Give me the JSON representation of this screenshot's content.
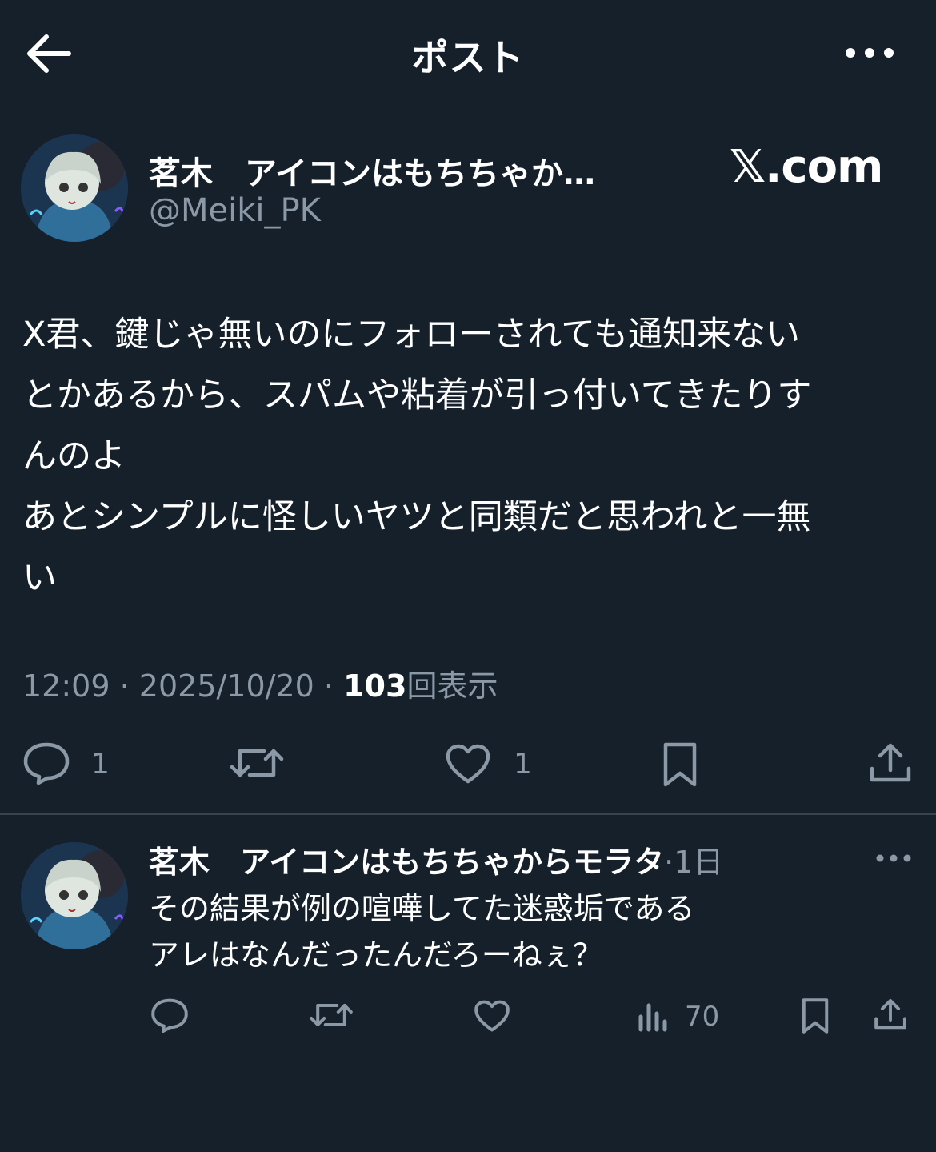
{
  "header": {
    "title": "ポスト",
    "back_icon": "arrow-left-icon",
    "more_icon": "more-horizontal-icon"
  },
  "post": {
    "author_name": "茗木　アイコンはもちちゃか…",
    "handle": "@Meiki_PK",
    "watermark": "𝕏.com",
    "body_lines": [
      "X君、鍵じゃ無いのにフォローされても通知来ない",
      "とかあるから、スパムや粘着が引っ付いてきたりす",
      "んのよ",
      "あとシンプルに怪しいヤツと同類だと思われと一無",
      "い"
    ],
    "time": "12:09",
    "sep": "·",
    "date": "2025/10/20",
    "views_count": "103",
    "views_label": "回表示",
    "actions": {
      "reply_count": "1",
      "like_count": "1"
    }
  },
  "reply": {
    "author_name": "茗木　アイコンはもちちゃからモラタ",
    "time": "·1日",
    "body_lines": [
      "その結果が例の喧嘩してた迷惑垢である",
      "アレはなんだったんだろーねぇ？"
    ],
    "views_count": "70"
  },
  "colors": {
    "background": "#15202b",
    "muted": "#8b98a5",
    "divider": "#38444d"
  }
}
